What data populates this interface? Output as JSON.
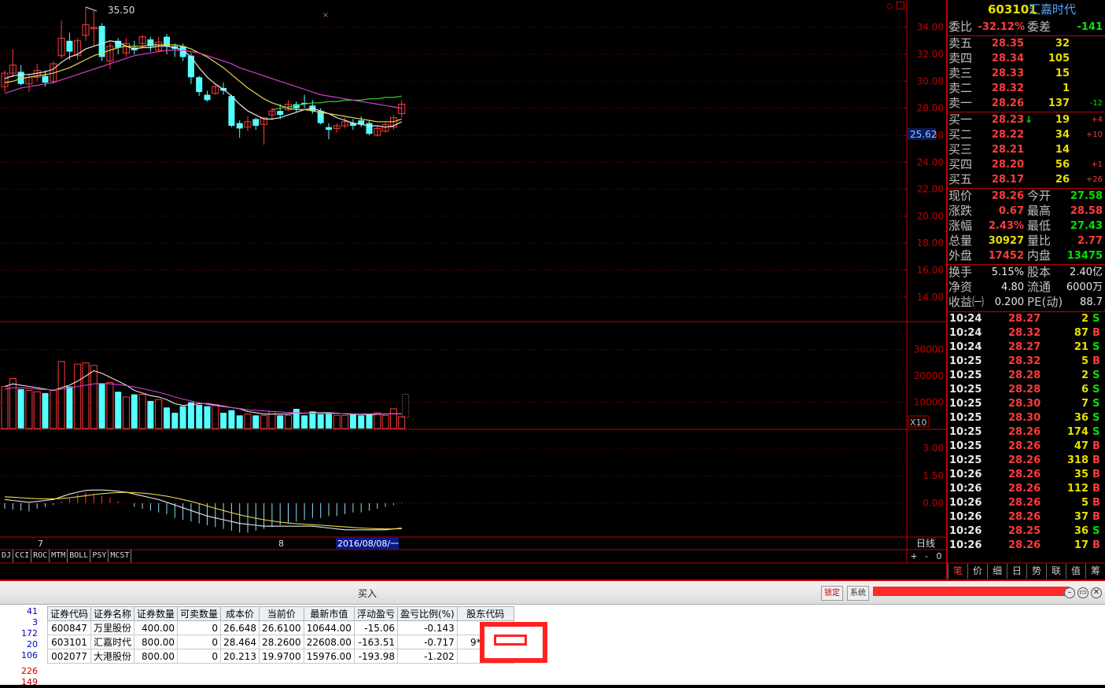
{
  "chart_data": [
    {
      "type": "candlestick",
      "y_ticks": [
        "34.00",
        "32.00",
        "30.00",
        "28.00",
        "26.00",
        "24.00",
        "22.00",
        "20.00",
        "18.00",
        "16.00",
        "14.00"
      ],
      "peak_label": "35.50",
      "price_marker": "25.62",
      "ylim": [
        13,
        35.5
      ],
      "candles": [
        [
          29.6,
          30.6,
          30.8,
          29.2
        ],
        [
          30.6,
          31.2,
          32.4,
          30.3
        ],
        [
          30.7,
          29.8,
          31.2,
          29.7
        ],
        [
          29.8,
          30.3,
          30.6,
          29.2
        ],
        [
          30.3,
          30.8,
          31.3,
          30.0
        ],
        [
          30.4,
          29.9,
          30.8,
          29.6
        ],
        [
          30.0,
          31.3,
          31.5,
          29.8
        ],
        [
          31.9,
          33.2,
          34.5,
          31.7
        ],
        [
          33.0,
          32.2,
          33.6,
          31.6
        ],
        [
          31.9,
          33.0,
          33.2,
          31.6
        ],
        [
          33.4,
          34.2,
          35.5,
          33.0
        ],
        [
          33.9,
          34.0,
          35.2,
          32.6
        ],
        [
          34.1,
          31.8,
          34.3,
          31.5
        ],
        [
          31.5,
          32.6,
          32.9,
          30.9
        ],
        [
          33.0,
          32.5,
          33.2,
          32.0
        ],
        [
          32.1,
          32.8,
          33.2,
          31.8
        ],
        [
          32.5,
          32.3,
          33.0,
          32.0
        ],
        [
          32.8,
          33.3,
          33.4,
          32.4
        ],
        [
          33.1,
          32.6,
          33.3,
          32.2
        ],
        [
          32.3,
          32.9,
          33.3,
          32.2
        ],
        [
          33.3,
          32.6,
          33.5,
          32.0
        ],
        [
          32.6,
          32.4,
          32.8,
          31.8
        ],
        [
          32.6,
          31.8,
          32.8,
          31.5
        ],
        [
          31.9,
          30.3,
          32.1,
          29.8
        ],
        [
          30.3,
          29.2,
          30.4,
          28.9
        ],
        [
          29.0,
          28.6,
          29.3,
          28.5
        ],
        [
          29.1,
          29.6,
          29.8,
          29.0
        ],
        [
          29.5,
          29.3,
          29.9,
          29.0
        ],
        [
          28.9,
          26.7,
          29.0,
          26.6
        ],
        [
          26.9,
          26.5,
          27.1,
          25.8
        ],
        [
          26.6,
          27.0,
          27.4,
          26.3
        ],
        [
          27.2,
          26.7,
          27.3,
          26.4
        ],
        [
          26.8,
          27.3,
          27.3,
          25.3
        ],
        [
          27.5,
          27.8,
          28.0,
          27.1
        ],
        [
          27.8,
          27.5,
          28.3,
          27.2
        ],
        [
          27.9,
          28.3,
          28.6,
          27.8
        ],
        [
          28.3,
          28.0,
          28.5,
          27.7
        ],
        [
          28.4,
          28.3,
          29.0,
          28.0
        ],
        [
          28.2,
          27.8,
          28.6,
          27.6
        ],
        [
          27.8,
          26.9,
          28.0,
          26.8
        ],
        [
          26.6,
          26.4,
          26.9,
          25.7
        ],
        [
          26.5,
          26.7,
          26.9,
          26.2
        ],
        [
          26.7,
          27.0,
          27.3,
          26.5
        ],
        [
          26.9,
          26.7,
          27.2,
          26.4
        ],
        [
          27.1,
          26.8,
          27.4,
          26.6
        ],
        [
          26.9,
          26.1,
          27.1,
          26.0
        ],
        [
          26.0,
          26.5,
          26.7,
          25.9
        ],
        [
          26.3,
          26.8,
          27.0,
          26.2
        ],
        [
          26.6,
          27.3,
          27.5,
          26.4
        ],
        [
          27.6,
          28.3,
          28.6,
          27.3
        ]
      ],
      "ma_lines": [
        {
          "color": "#e6e6e6",
          "values": [
            30.2,
            30.4,
            30.5,
            30.5,
            30.6,
            30.7,
            30.9,
            31.4,
            31.8,
            32.0,
            32.4,
            32.6,
            32.8,
            33.0,
            32.9,
            32.6,
            32.4,
            32.5,
            32.5,
            32.6,
            32.6,
            32.5,
            32.3,
            31.8,
            31.0,
            30.3,
            29.8,
            29.4,
            28.9,
            28.3,
            27.8,
            27.5,
            27.2,
            27.2,
            27.3,
            27.5,
            27.7,
            27.9,
            28.0,
            27.8,
            27.6,
            27.3,
            27.1,
            26.9,
            26.8,
            26.7,
            26.7,
            26.6,
            26.7,
            27.0
          ]
        },
        {
          "color": "#e8d84a",
          "values": [
            29.9,
            30.0,
            30.2,
            30.3,
            30.4,
            30.5,
            30.6,
            30.8,
            31.0,
            31.3,
            31.6,
            31.9,
            32.1,
            32.3,
            32.5,
            32.6,
            32.6,
            32.6,
            32.7,
            32.7,
            32.7,
            32.7,
            32.6,
            32.4,
            32.1,
            31.8,
            31.4,
            31.0,
            30.5,
            30.0,
            29.5,
            29.1,
            28.7,
            28.4,
            28.2,
            28.0,
            27.9,
            27.9,
            27.8,
            27.7,
            27.6,
            27.5,
            27.4,
            27.3,
            27.2,
            27.1,
            27.0,
            27.0,
            27.0,
            27.2
          ]
        },
        {
          "color": "#3ad03a",
          "from": 33,
          "values": [
            null,
            null,
            null,
            null,
            null,
            null,
            null,
            null,
            null,
            null,
            null,
            null,
            null,
            null,
            null,
            null,
            null,
            null,
            null,
            null,
            null,
            null,
            null,
            null,
            null,
            null,
            null,
            null,
            null,
            null,
            null,
            null,
            null,
            27.9,
            28.0,
            28.1,
            28.2,
            28.3,
            28.4,
            28.4,
            28.5,
            28.5,
            28.6,
            28.6,
            28.6,
            28.7,
            28.7,
            28.8,
            28.8,
            28.9
          ]
        },
        {
          "color": "#d040d0",
          "values": [
            29.1,
            29.3,
            29.5,
            29.6,
            29.7,
            29.8,
            29.9,
            30.1,
            30.3,
            30.5,
            30.7,
            30.9,
            31.1,
            31.3,
            31.5,
            31.7,
            31.9,
            32.0,
            32.1,
            32.2,
            32.3,
            32.3,
            32.3,
            32.2,
            32.1,
            31.9,
            31.7,
            31.5,
            31.3,
            31.0,
            30.8,
            30.6,
            30.4,
            30.2,
            30.0,
            29.8,
            29.6,
            29.4,
            29.2,
            29.0,
            28.9,
            28.8,
            28.7,
            28.6,
            28.5,
            28.4,
            28.3,
            28.2,
            28.1,
            28.0
          ]
        }
      ]
    },
    {
      "type": "bar",
      "name": "volume",
      "y_ticks": [
        "30000",
        "20000",
        "10000"
      ],
      "unit_label": "X10",
      "ylim": [
        0,
        38000
      ],
      "values": [
        16000,
        19000,
        15000,
        14500,
        14000,
        13500,
        14500,
        25500,
        16000,
        24500,
        25000,
        24000,
        17000,
        17500,
        14000,
        12000,
        13000,
        13000,
        10500,
        11000,
        8000,
        6000,
        8500,
        10000,
        9000,
        8500,
        9000,
        6000,
        7000,
        5000,
        5500,
        5000,
        5000,
        6500,
        5000,
        5000,
        7500,
        5000,
        6500,
        5500,
        6000,
        5000,
        5000,
        5500,
        5000,
        5500,
        6000,
        5000,
        7500,
        4500
      ],
      "ma": [
        {
          "color": "#e6e6e6",
          "values": [
            16000,
            17000,
            16500,
            16000,
            15500,
            15000,
            14500,
            15500,
            16500,
            18000,
            20000,
            22000,
            21000,
            19500,
            18000,
            16500,
            14500,
            13500,
            12500,
            12000,
            11000,
            9500,
            8800,
            9000,
            9500,
            9500,
            9000,
            8500,
            8000,
            7500,
            6500,
            6000,
            5500,
            5500,
            5500,
            5500,
            5800,
            5800,
            6000,
            6000,
            6000,
            5800,
            5600,
            5400,
            5400,
            5300,
            5400,
            5500,
            5600,
            5600
          ]
        },
        {
          "color": "#d040d0",
          "values": [
            15000,
            15500,
            15500,
            15300,
            15000,
            14800,
            14700,
            15000,
            15500,
            16000,
            16500,
            17000,
            17200,
            17000,
            16800,
            16300,
            15800,
            15200,
            14500,
            13800,
            13000,
            12000,
            11200,
            10500,
            9800,
            9200,
            8700,
            8300,
            8000,
            7600,
            7200,
            6900,
            6700,
            6500,
            6300,
            6100,
            6000,
            5900,
            5800,
            5800,
            5700,
            5700,
            5700,
            5600,
            5600,
            5600,
            5600,
            5600,
            5600,
            5600
          ]
        }
      ]
    },
    {
      "type": "macd",
      "y_ticks": [
        "3.00",
        "1.50",
        "0.00"
      ],
      "ylim": [
        -1.8,
        3.6
      ],
      "dif": [
        0.2,
        0.15,
        0.1,
        0.05,
        0.1,
        0.15,
        0.2,
        0.35,
        0.5,
        0.6,
        0.7,
        0.72,
        0.72,
        0.7,
        0.65,
        0.6,
        0.5,
        0.4,
        0.3,
        0.2,
        0.05,
        -0.1,
        -0.25,
        -0.4,
        -0.55,
        -0.7,
        -0.8,
        -0.9,
        -1.0,
        -1.1,
        -1.15,
        -1.2,
        -1.25,
        -1.25,
        -1.25,
        -1.25,
        -1.25,
        -1.25,
        -1.25,
        -1.3,
        -1.35,
        -1.4,
        -1.45,
        -1.45,
        -1.45,
        -1.45,
        -1.45,
        -1.45,
        -1.4,
        -1.35
      ],
      "dea": [
        0.35,
        0.33,
        0.3,
        0.27,
        0.25,
        0.24,
        0.24,
        0.26,
        0.3,
        0.35,
        0.41,
        0.47,
        0.52,
        0.56,
        0.58,
        0.59,
        0.58,
        0.55,
        0.51,
        0.45,
        0.38,
        0.3,
        0.2,
        0.1,
        -0.02,
        -0.15,
        -0.28,
        -0.4,
        -0.52,
        -0.63,
        -0.73,
        -0.82,
        -0.9,
        -0.97,
        -1.03,
        -1.08,
        -1.12,
        -1.15,
        -1.17,
        -1.2,
        -1.23,
        -1.26,
        -1.29,
        -1.32,
        -1.35,
        -1.37,
        -1.39,
        -1.4,
        -1.4,
        -1.39
      ],
      "hist": [
        -0.3,
        -0.35,
        -0.4,
        -0.45,
        -0.3,
        -0.2,
        -0.1,
        0.1,
        0.3,
        0.5,
        0.6,
        0.5,
        0.4,
        0.3,
        0.1,
        0.0,
        -0.2,
        -0.3,
        -0.4,
        -0.5,
        -0.6,
        -0.8,
        -0.9,
        -1.0,
        -1.1,
        -1.2,
        -1.3,
        -1.4,
        -1.5,
        -1.6,
        -1.6,
        -1.5,
        -1.4,
        -1.3,
        -1.2,
        -1.1,
        -1.0,
        -0.9,
        -0.8,
        -0.8,
        -0.7,
        -0.7,
        -0.6,
        -0.5,
        -0.5,
        -0.4,
        -0.3,
        -0.2,
        -0.1,
        0.05
      ]
    }
  ],
  "header": {
    "code": "603101",
    "name": "汇嘉时代"
  },
  "weibi": {
    "label1": "委比",
    "val1": "-32.12%",
    "label2": "委差",
    "val2": "-141"
  },
  "sells": [
    {
      "label": "卖五",
      "price": "28.35",
      "vol": "32",
      "chg": ""
    },
    {
      "label": "卖四",
      "price": "28.34",
      "vol": "105",
      "chg": ""
    },
    {
      "label": "卖三",
      "price": "28.33",
      "vol": "15",
      "chg": ""
    },
    {
      "label": "卖二",
      "price": "28.32",
      "vol": "1",
      "chg": ""
    },
    {
      "label": "卖一",
      "price": "28.26",
      "vol": "137",
      "chg": "-12"
    }
  ],
  "buys": [
    {
      "label": "买一",
      "price": "28.23",
      "arrow": "↓",
      "vol": "19",
      "chg": "+4"
    },
    {
      "label": "买二",
      "price": "28.22",
      "arrow": "",
      "vol": "34",
      "chg": "+10"
    },
    {
      "label": "买三",
      "price": "28.21",
      "arrow": "",
      "vol": "14",
      "chg": ""
    },
    {
      "label": "买四",
      "price": "28.20",
      "arrow": "",
      "vol": "56",
      "chg": "+1"
    },
    {
      "label": "买五",
      "price": "28.17",
      "arrow": "",
      "vol": "26",
      "chg": "+26"
    }
  ],
  "quote": [
    {
      "l1": "现价",
      "v1": "28.26",
      "c1": "red",
      "l2": "今开",
      "v2": "27.58",
      "c2": "grn"
    },
    {
      "l1": "涨跌",
      "v1": "0.67",
      "c1": "red",
      "l2": "最高",
      "v2": "28.58",
      "c2": "red"
    },
    {
      "l1": "涨幅",
      "v1": "2.43%",
      "c1": "red",
      "l2": "最低",
      "v2": "27.43",
      "c2": "grn"
    },
    {
      "l1": "总量",
      "v1": "30927",
      "c1": "yel",
      "l2": "量比",
      "v2": "2.77",
      "c2": "red"
    },
    {
      "l1": "外盘",
      "v1": "17452",
      "c1": "red",
      "l2": "内盘",
      "v2": "13475",
      "c2": "grn"
    }
  ],
  "fundamentals": [
    {
      "l1": "换手",
      "v1": "5.15%",
      "l2": "股本",
      "v2": "2.40亿"
    },
    {
      "l1": "净资",
      "v1": "4.80",
      "l2": "流通",
      "v2": "6000万"
    },
    {
      "l1": "收益㈠",
      "v1": "0.200",
      "l2": "PE(动)",
      "v2": "88.7"
    }
  ],
  "ticks": [
    {
      "t": "10:24",
      "p": "28.27",
      "pc": "red",
      "v": "2",
      "vc": "yel",
      "s": "S",
      "sc": "grn"
    },
    {
      "t": "10:24",
      "p": "28.32",
      "pc": "red",
      "v": "87",
      "vc": "yel",
      "s": "B",
      "sc": "red"
    },
    {
      "t": "10:24",
      "p": "28.27",
      "pc": "red",
      "v": "21",
      "vc": "yel",
      "s": "S",
      "sc": "grn"
    },
    {
      "t": "10:25",
      "p": "28.32",
      "pc": "red",
      "v": "5",
      "vc": "yel",
      "s": "B",
      "sc": "red"
    },
    {
      "t": "10:25",
      "p": "28.28",
      "pc": "red",
      "v": "2",
      "vc": "yel",
      "s": "S",
      "sc": "grn"
    },
    {
      "t": "10:25",
      "p": "28.28",
      "pc": "red",
      "v": "6",
      "vc": "yel",
      "s": "S",
      "sc": "grn"
    },
    {
      "t": "10:25",
      "p": "28.30",
      "pc": "red",
      "v": "7",
      "vc": "yel",
      "s": "S",
      "sc": "grn"
    },
    {
      "t": "10:25",
      "p": "28.30",
      "pc": "red",
      "v": "36",
      "vc": "yel",
      "s": "S",
      "sc": "grn"
    },
    {
      "t": "10:25",
      "p": "28.26",
      "pc": "red",
      "v": "174",
      "vc": "yel",
      "s": "S",
      "sc": "grn"
    },
    {
      "t": "10:25",
      "p": "28.26",
      "pc": "red",
      "v": "47",
      "vc": "yel",
      "s": "B",
      "sc": "red"
    },
    {
      "t": "10:25",
      "p": "28.26",
      "pc": "red",
      "v": "318",
      "vc": "yel",
      "s": "B",
      "sc": "red"
    },
    {
      "t": "10:26",
      "p": "28.26",
      "pc": "red",
      "v": "35",
      "vc": "yel",
      "s": "B",
      "sc": "red"
    },
    {
      "t": "10:26",
      "p": "28.26",
      "pc": "red",
      "v": "112",
      "vc": "yel",
      "s": "B",
      "sc": "red"
    },
    {
      "t": "10:26",
      "p": "28.26",
      "pc": "red",
      "v": "5",
      "vc": "yel",
      "s": "B",
      "sc": "red"
    },
    {
      "t": "10:26",
      "p": "28.26",
      "pc": "red",
      "v": "37",
      "vc": "yel",
      "s": "B",
      "sc": "red"
    },
    {
      "t": "10:26",
      "p": "28.25",
      "pc": "red",
      "v": "36",
      "vc": "yel",
      "s": "S",
      "sc": "grn"
    },
    {
      "t": "10:26",
      "p": "28.26",
      "pc": "red",
      "v": "17",
      "vc": "yel",
      "s": "B",
      "sc": "red"
    }
  ],
  "axis": {
    "date1": "7",
    "date2": "8",
    "cursor_date": "2016/08/08/一",
    "period": "日线",
    "zoom_plus": "+",
    "zoom_minus": "-",
    "zero": "0"
  },
  "indicator_tabs": [
    "DJ",
    "CCI",
    "ROC",
    "MTM",
    "BOLL",
    "PSY",
    "MCST"
  ],
  "right_tabs": [
    "笔",
    "价",
    "细",
    "日",
    "势",
    "联",
    "值",
    "筹"
  ],
  "trade": {
    "title": "买入",
    "btn_lock": "锁定",
    "btn_sys": "系统",
    "left_nums": [
      "41",
      "3",
      "172",
      "20",
      "106",
      "226",
      "149"
    ],
    "headers": [
      "证券代码",
      "证券名称",
      "证券数量",
      "可卖数量",
      "成本价",
      "当前价",
      "最新市值",
      "浮动盈亏",
      "盈亏比例(%)",
      "股东代码"
    ],
    "rows": [
      [
        "600847",
        "万里股份",
        "400.00",
        "0",
        "26.648",
        "26.6100",
        "10644.00",
        "-15.06",
        "-0.143",
        ""
      ],
      [
        "603101",
        "汇嘉时代",
        "800.00",
        "0",
        "28.464",
        "28.2600",
        "22608.00",
        "-163.51",
        "-0.717",
        "9*86769"
      ],
      [
        "002077",
        "大港股份",
        "800.00",
        "0",
        "20.213",
        "19.9700",
        "15976.00",
        "-193.98",
        "-1.202",
        ""
      ]
    ]
  },
  "colors": {
    "up": "#ff3b3b",
    "down": "#54ffff",
    "grid": "#8b0000",
    "axis": "#c00000"
  }
}
